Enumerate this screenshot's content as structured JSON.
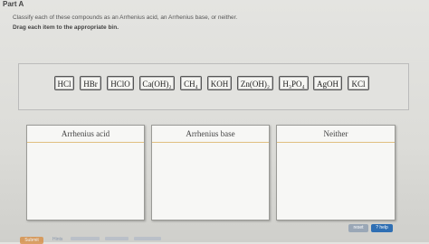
{
  "part": {
    "title": "Part A"
  },
  "instructions": "Classify each of these compounds as an Arrhenius acid, an Arrhenius base, or neither.",
  "drag_hint": "Drag each item to the appropriate bin.",
  "items": [
    {
      "label": "HCl"
    },
    {
      "label": "HBr"
    },
    {
      "label": "HClO"
    },
    {
      "label": "Ca(OH)₂"
    },
    {
      "label": "CH₄"
    },
    {
      "label": "KOH"
    },
    {
      "label": "Zn(OH)₂"
    },
    {
      "label": "H₃PO₄"
    },
    {
      "label": "AgOH"
    },
    {
      "label": "KCl"
    }
  ],
  "bins": [
    {
      "label": "Arrhenius acid"
    },
    {
      "label": "Arrhenius base"
    },
    {
      "label": "Neither"
    }
  ],
  "controls": {
    "reset_label": "reset",
    "help_label": "? help",
    "submit_label": "Submit",
    "hints_label": "Hints"
  },
  "colors": {
    "help_button": "#2f6fb3",
    "reset_button": "#9aa7b6",
    "submit_button": "#d98a3c",
    "bin_divider": "#e0c080"
  }
}
